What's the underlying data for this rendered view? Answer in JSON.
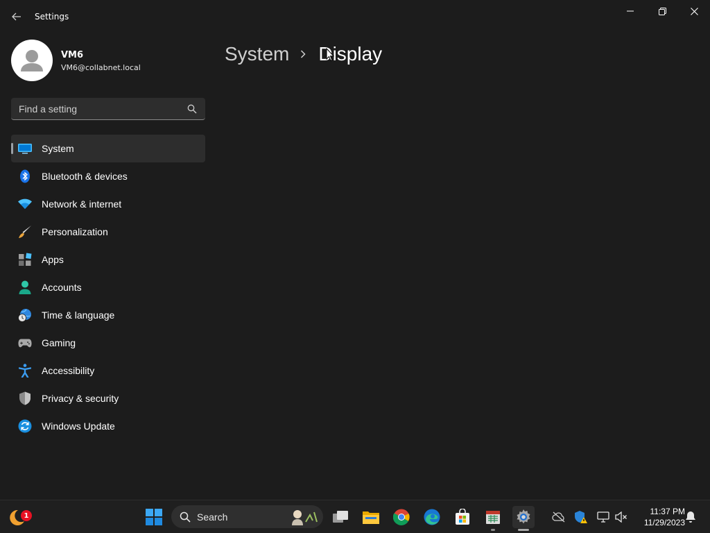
{
  "window": {
    "title": "Settings"
  },
  "profile": {
    "name": "VM6",
    "email": "VM6@collabnet.local"
  },
  "search": {
    "placeholder": "Find a setting"
  },
  "nav": {
    "items": [
      {
        "label": "System",
        "icon": "system-display-icon",
        "active": true
      },
      {
        "label": "Bluetooth & devices",
        "icon": "bluetooth-icon"
      },
      {
        "label": "Network & internet",
        "icon": "wifi-icon"
      },
      {
        "label": "Personalization",
        "icon": "paintbrush-icon"
      },
      {
        "label": "Apps",
        "icon": "apps-icon"
      },
      {
        "label": "Accounts",
        "icon": "person-icon"
      },
      {
        "label": "Time & language",
        "icon": "globe-clock-icon"
      },
      {
        "label": "Gaming",
        "icon": "gamepad-icon"
      },
      {
        "label": "Accessibility",
        "icon": "accessibility-icon"
      },
      {
        "label": "Privacy & security",
        "icon": "shield-icon"
      },
      {
        "label": "Windows Update",
        "icon": "refresh-icon"
      }
    ]
  },
  "breadcrumb": {
    "parent": "System",
    "current": "Display"
  },
  "taskbar": {
    "search_label": "Search",
    "widget_badge": "1",
    "time": "11:37 PM",
    "date": "11/29/2023"
  },
  "colors": {
    "background": "#1c1c1c",
    "nav_active": "#2d2d2d",
    "accent_blue": "#4cc2ff"
  }
}
